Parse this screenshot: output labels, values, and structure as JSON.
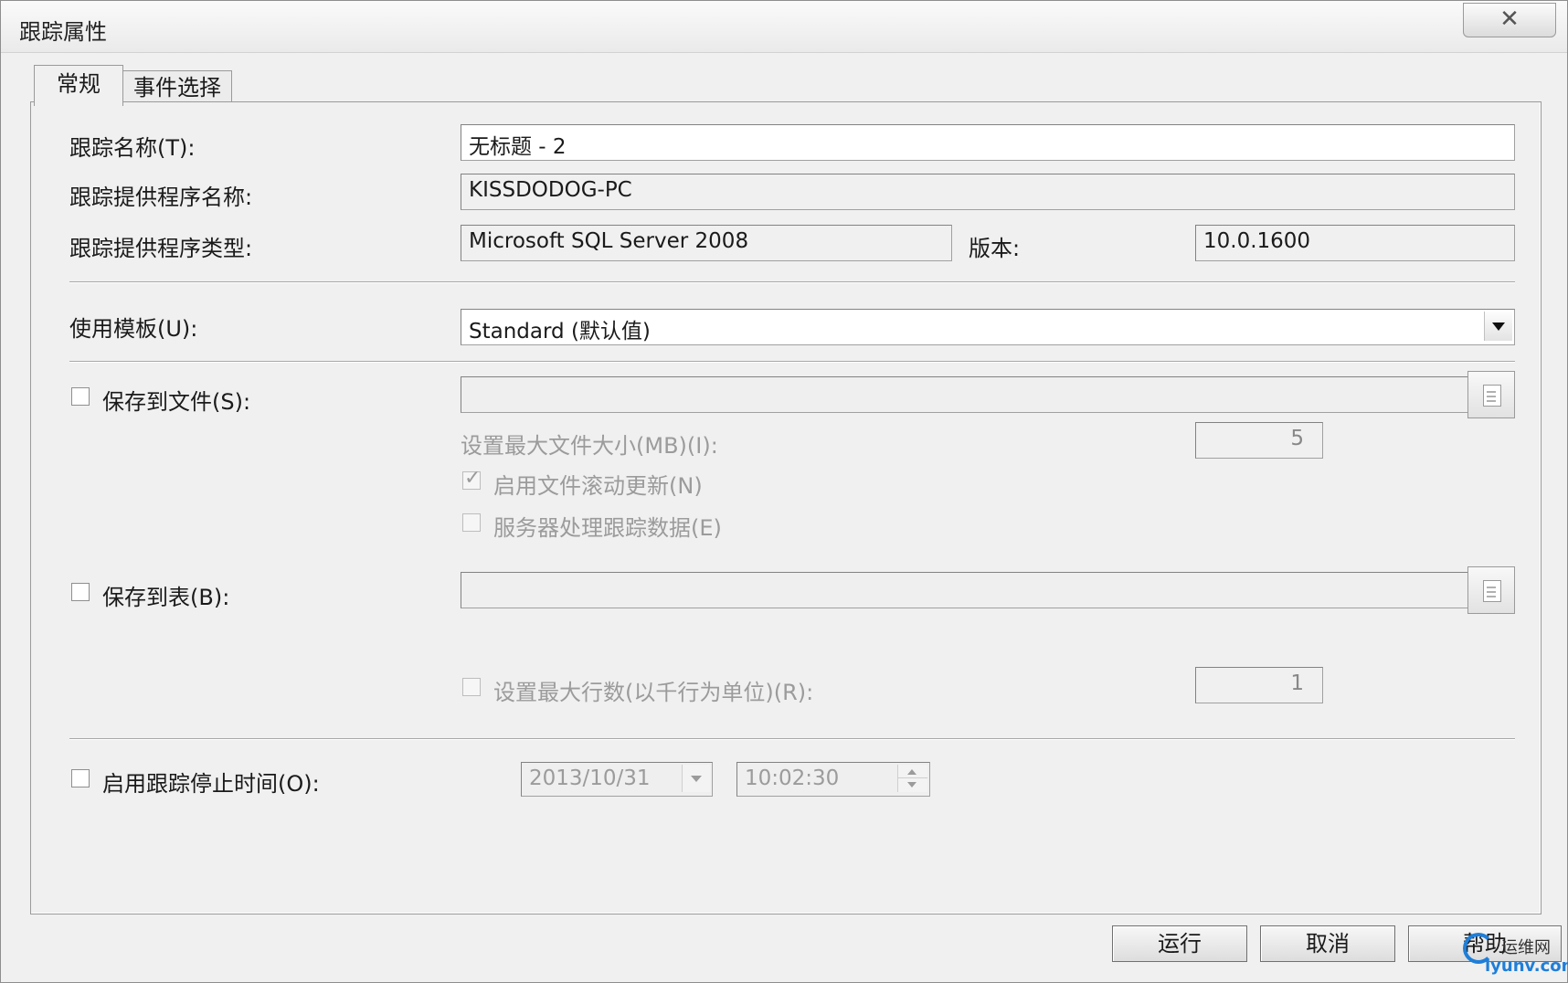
{
  "window": {
    "title": "跟踪属性",
    "close_glyph": "✕"
  },
  "tabs": [
    {
      "label": "常规",
      "active": true
    },
    {
      "label": "事件选择",
      "active": false
    }
  ],
  "general": {
    "trace_name_label": "跟踪名称(T):",
    "trace_name_value": "无标题 - 2",
    "provider_name_label": "跟踪提供程序名称:",
    "provider_name_value": "KISSDODOG-PC",
    "provider_type_label": "跟踪提供程序类型:",
    "provider_type_value": "Microsoft SQL Server 2008",
    "version_label": "版本:",
    "version_value": "10.0.1600",
    "template_label": "使用模板(U):",
    "template_value": "Standard (默认值)",
    "save_to_file_label": "保存到文件(S):",
    "save_to_file_checked": false,
    "save_to_file_path": "",
    "max_file_size_label": "设置最大文件大小(MB)(I):",
    "max_file_size_value": "5",
    "file_rollover_label": "启用文件滚动更新(N)",
    "file_rollover_checked": true,
    "server_process_label": "服务器处理跟踪数据(E)",
    "server_process_checked": false,
    "save_to_table_label": "保存到表(B):",
    "save_to_table_checked": false,
    "save_to_table_value": "",
    "max_rows_label": "设置最大行数(以千行为单位)(R):",
    "max_rows_checked": false,
    "max_rows_value": "1",
    "stop_time_label": "启用跟踪停止时间(O):",
    "stop_time_checked": false,
    "stop_date_value": "2013/10/31",
    "stop_time_value": "10:02:30"
  },
  "buttons": {
    "run": "运行",
    "cancel": "取消",
    "help": "帮助"
  },
  "watermark": {
    "cn": "运维网",
    "en": "iyunv.com"
  },
  "colors": {
    "disabled_text": "#9b9b9b",
    "window_bg": "#f0f0f0",
    "watermark_blue": "#1f7ed8"
  }
}
